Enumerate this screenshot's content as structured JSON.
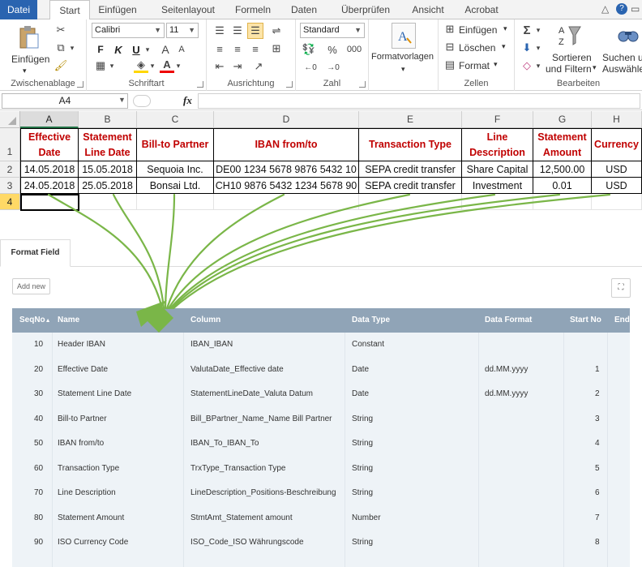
{
  "ribbon": {
    "tabs": [
      "Datei",
      "Start",
      "Einfügen",
      "Seitenlayout",
      "Formeln",
      "Daten",
      "Überprüfen",
      "Ansicht",
      "Acrobat"
    ],
    "groups": {
      "clipboard": {
        "label": "Zwischenablage",
        "paste": "Einfügen"
      },
      "font": {
        "label": "Schriftart",
        "font_name": "Calibri",
        "font_size": "11",
        "bold": "F",
        "italic": "K",
        "underline": "U"
      },
      "alignment": {
        "label": "Ausrichtung"
      },
      "number": {
        "label": "Zahl",
        "format": "Standard",
        "percent": "%",
        "thousands": "000"
      },
      "styles": {
        "label": "Formatvorlagen"
      },
      "cells": {
        "label": "Zellen",
        "insert": "Einfügen",
        "delete": "Löschen",
        "format": "Format"
      },
      "editing": {
        "label": "Bearbeiten",
        "sort": "Sortieren",
        "sort2": "und Filtern",
        "find": "Suchen u",
        "find2": "Auswähle"
      }
    }
  },
  "formula_bar": {
    "name_box": "A4",
    "fx": "fx",
    "value": ""
  },
  "sheet": {
    "columns": [
      "A",
      "B",
      "C",
      "D",
      "E",
      "F",
      "G",
      "H"
    ],
    "rows": [
      "1",
      "2",
      "3",
      "4"
    ],
    "header_row": [
      "Effective Date",
      "Statement Line Date",
      "Bill-to Partner",
      "IBAN from/to",
      "Transaction Type",
      "Line Description",
      "Statement Amount",
      "Currency"
    ],
    "data_rows": [
      [
        "14.05.2018",
        "15.05.2018",
        "Sequoia Inc.",
        "DE00 1234 5678 9876 5432 10",
        "SEPA credit transfer",
        "Share Capital",
        "12,500.00",
        "USD"
      ],
      [
        "24.05.2018",
        "25.05.2018",
        "Bonsai Ltd.",
        "CH10 9876 5432 1234 5678 90",
        "SEPA credit transfer",
        "Investment",
        "0.01",
        "USD"
      ]
    ],
    "active_cell": "A4"
  },
  "format_field": {
    "tab_label": "Format Field",
    "add_new": "Add new",
    "columns": [
      "SeqNo",
      "Name",
      "Column",
      "Data Type",
      "Data Format",
      "Start No",
      "End"
    ],
    "sort_indicator": "▲",
    "rows": [
      {
        "seq": "10",
        "name": "Header IBAN",
        "column": "IBAN_IBAN",
        "type": "Constant",
        "format": "",
        "start": ""
      },
      {
        "seq": "20",
        "name": "Effective Date",
        "column": "ValutaDate_Effective date",
        "type": "Date",
        "format": "dd.MM.yyyy",
        "start": "1"
      },
      {
        "seq": "30",
        "name": "Statement Line Date",
        "column": "StatementLineDate_Valuta Datum",
        "type": "Date",
        "format": "dd.MM.yyyy",
        "start": "2"
      },
      {
        "seq": "40",
        "name": "Bill-to Partner",
        "column": "Bill_BPartner_Name_Name Bill Partner",
        "type": "String",
        "format": "",
        "start": "3"
      },
      {
        "seq": "50",
        "name": "IBAN from/to",
        "column": "IBAN_To_IBAN_To",
        "type": "String",
        "format": "",
        "start": "4"
      },
      {
        "seq": "60",
        "name": "Transaction Type",
        "column": "TrxType_Transaction Type",
        "type": "String",
        "format": "",
        "start": "5"
      },
      {
        "seq": "70",
        "name": "Line Description",
        "column": "LineDescription_Positions-Beschreibung",
        "type": "String",
        "format": "",
        "start": "6"
      },
      {
        "seq": "80",
        "name": "Statement Amount",
        "column": "StmtAmt_Statement amount",
        "type": "Number",
        "format": "",
        "start": "7"
      },
      {
        "seq": "90",
        "name": "ISO Currency Code",
        "column": "ISO_Code_ISO Währungscode",
        "type": "String",
        "format": "",
        "start": "8"
      }
    ]
  },
  "colors": {
    "excel_green": "#217346",
    "file_tab": "#2a64b0",
    "header_red": "#c00000",
    "arrow_green": "#7ab648",
    "table_header": "#90a4b7"
  }
}
